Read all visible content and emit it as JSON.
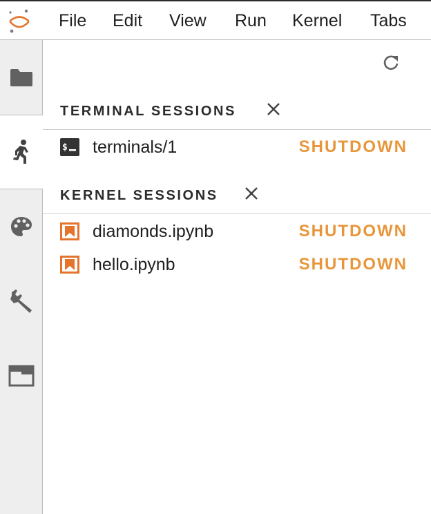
{
  "menubar": {
    "items": [
      "File",
      "Edit",
      "View",
      "Run",
      "Kernel",
      "Tabs"
    ]
  },
  "sidebar": {
    "tabs": [
      {
        "icon": "folder-icon"
      },
      {
        "icon": "running-icon"
      },
      {
        "icon": "palette-icon"
      },
      {
        "icon": "wrench-icon"
      },
      {
        "icon": "tabs-icon"
      }
    ]
  },
  "panel": {
    "refresh_icon": "refresh-icon",
    "terminal_section": {
      "title": "TERMINAL SESSIONS",
      "items": [
        {
          "name": "terminals/1",
          "action": "SHUTDOWN",
          "icon": "terminal-icon"
        }
      ]
    },
    "kernel_section": {
      "title": "KERNEL SESSIONS",
      "items": [
        {
          "name": "diamonds.ipynb",
          "action": "SHUTDOWN",
          "icon": "notebook-icon"
        },
        {
          "name": "hello.ipynb",
          "action": "SHUTDOWN",
          "icon": "notebook-icon"
        }
      ]
    }
  },
  "colors": {
    "accent_orange": "#e8963a",
    "notebook_orange": "#e4742c",
    "icon_gray": "#616161",
    "sidebar_bg": "#eeeeee"
  }
}
